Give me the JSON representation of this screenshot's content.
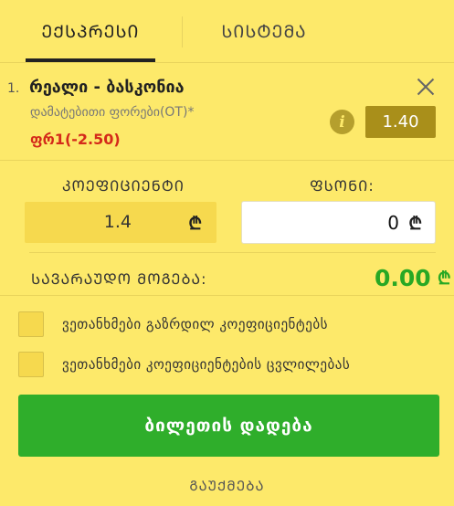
{
  "tabs": {
    "express_label": "ᲔᲥᲡᲞᲠᲔᲡᲘ",
    "system_label": "ᲡᲘᲡᲢᲔᲛᲐ"
  },
  "bet": {
    "index": "1.",
    "match": "რეალი - ბასკონია",
    "market": "დამატებითი ფორები(OT)*",
    "selection": "ფრ1(-2.50)",
    "odds": "1.40",
    "info_symbol": "i"
  },
  "form": {
    "coefficient_label": "ᲙᲝᲔᲤᲘᲪᲘᲔᲜᲢᲘ",
    "stake_label": "ᲤᲡᲝᲜᲘ:",
    "coefficient_value": "1.4",
    "stake_value": "0",
    "currency_symbol": "₾"
  },
  "winnings": {
    "label": "ᲡᲐᲕᲐᲠᲐᲣᲓᲝ ᲛᲝᲒᲔᲑᲐ:",
    "value": "0.00",
    "currency_symbol": "₾"
  },
  "options": [
    {
      "label": "ვეთანხმები გაზრდილ კოეფიციენტებს"
    },
    {
      "label": "ვეთანხმები კოეფიციენტების ცვლილებას"
    }
  ],
  "actions": {
    "place_bet_label": "ბილეთის დადება",
    "cancel_label": "ᲒᲐᲣᲥᲛᲔᲑᲐ"
  },
  "colors": {
    "background": "#fde96a",
    "accent_green": "#2fae2b",
    "selection_red": "#d42a1a",
    "odds_badge": "#a98f1a"
  },
  "icons": {
    "close": "close-icon",
    "info": "info-icon",
    "currency": "lari-icon"
  }
}
